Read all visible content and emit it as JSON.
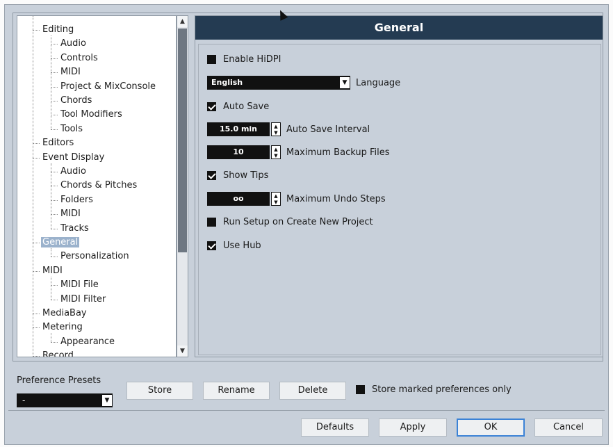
{
  "tree": {
    "items": [
      {
        "label": "Editing",
        "level": 0
      },
      {
        "label": "Audio",
        "level": 1
      },
      {
        "label": "Controls",
        "level": 1
      },
      {
        "label": "MIDI",
        "level": 1
      },
      {
        "label": "Project & MixConsole",
        "level": 1
      },
      {
        "label": "Chords",
        "level": 1
      },
      {
        "label": "Tool Modifiers",
        "level": 1
      },
      {
        "label": "Tools",
        "level": 1
      },
      {
        "label": "Editors",
        "level": 0
      },
      {
        "label": "Event Display",
        "level": 0
      },
      {
        "label": "Audio",
        "level": 1
      },
      {
        "label": "Chords & Pitches",
        "level": 1
      },
      {
        "label": "Folders",
        "level": 1
      },
      {
        "label": "MIDI",
        "level": 1
      },
      {
        "label": "Tracks",
        "level": 1
      },
      {
        "label": "General",
        "level": 0,
        "selected": true
      },
      {
        "label": "Personalization",
        "level": 1
      },
      {
        "label": "MIDI",
        "level": 0
      },
      {
        "label": "MIDI File",
        "level": 1
      },
      {
        "label": "MIDI Filter",
        "level": 1
      },
      {
        "label": "MediaBay",
        "level": 0
      },
      {
        "label": "Metering",
        "level": 0
      },
      {
        "label": "Appearance",
        "level": 1
      },
      {
        "label": "Record",
        "level": 0
      }
    ]
  },
  "scroll": {
    "up": "▲",
    "down": "▼"
  },
  "panel": {
    "title": "General",
    "enable_hidpi": {
      "label": "Enable HiDPI",
      "checked": false
    },
    "language": {
      "value": "English",
      "label": "Language",
      "arrow": "▼"
    },
    "auto_save": {
      "label": "Auto Save",
      "checked": true
    },
    "auto_save_interval": {
      "value": "15.0 min",
      "label": "Auto Save Interval"
    },
    "max_backup": {
      "value": "10",
      "label": "Maximum Backup Files"
    },
    "show_tips": {
      "label": "Show Tips",
      "checked": true
    },
    "max_undo": {
      "value": "oo",
      "label": "Maximum Undo Steps"
    },
    "run_setup": {
      "label": "Run Setup on Create New Project",
      "checked": false
    },
    "use_hub": {
      "label": "Use Hub",
      "checked": true
    }
  },
  "spin": {
    "up": "▲",
    "down": "▼"
  },
  "bottom": {
    "presets_label": "Preference Presets",
    "presets_value": "-",
    "presets_arrow": "▼",
    "store": "Store",
    "rename": "Rename",
    "delete": "Delete",
    "store_marked_only": "Store marked preferences only",
    "defaults": "Defaults",
    "apply": "Apply",
    "ok": "OK",
    "cancel": "Cancel"
  }
}
